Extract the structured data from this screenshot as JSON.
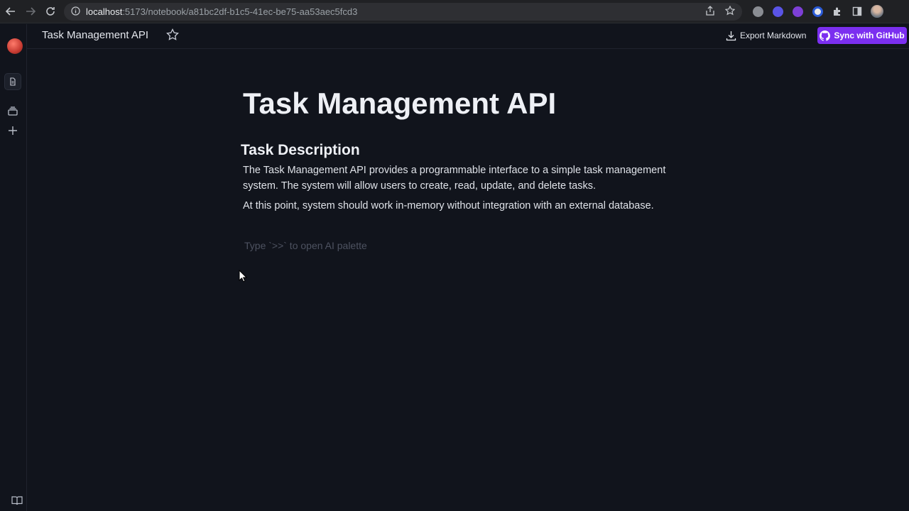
{
  "browser": {
    "url_host": "localhost",
    "url_path": ":5173/notebook/a81bc2df-b1c5-41ec-be75-aa53aec5fcd3"
  },
  "header": {
    "doc_title": "Task Management API",
    "export_label": "Export Markdown",
    "sync_label": "Sync with GitHub",
    "accent": "#7b2ff0"
  },
  "doc": {
    "title": "Task Management API",
    "section_heading": "Task Description",
    "paragraphs": [
      "The Task Management API provides a programmable interface to a simple task management system. The system will allow users to create, read, update, and delete tasks.",
      "At this point, system should work in-memory without integration with an external database."
    ],
    "editor_placeholder": "Type `>>` to open AI palette"
  }
}
